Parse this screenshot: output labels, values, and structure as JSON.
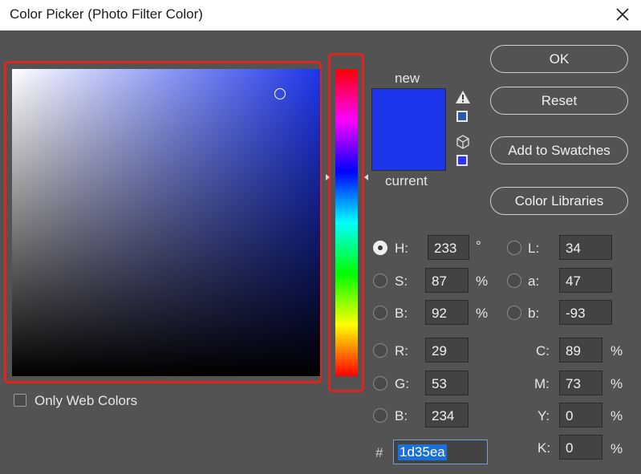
{
  "window": {
    "title": "Color Picker (Photo Filter Color)"
  },
  "preview": {
    "new_label": "new",
    "current_label": "current",
    "new_color": "#1d35ea",
    "current_color": "#1d35ea"
  },
  "buttons": {
    "ok": "OK",
    "reset": "Reset",
    "add_to_swatches": "Add to Swatches",
    "color_libraries": "Color Libraries"
  },
  "hsb": {
    "h": {
      "label": "H:",
      "value": "233",
      "unit": "°"
    },
    "s": {
      "label": "S:",
      "value": "87",
      "unit": "%"
    },
    "b": {
      "label": "B:",
      "value": "92",
      "unit": "%"
    }
  },
  "rgb": {
    "r": {
      "label": "R:",
      "value": "29"
    },
    "g": {
      "label": "G:",
      "value": "53"
    },
    "b": {
      "label": "B:",
      "value": "234"
    }
  },
  "lab": {
    "l": {
      "label": "L:",
      "value": "34"
    },
    "a": {
      "label": "a:",
      "value": "47"
    },
    "b": {
      "label": "b:",
      "value": "-93"
    }
  },
  "cmyk": {
    "c": {
      "label": "C:",
      "value": "89",
      "unit": "%"
    },
    "m": {
      "label": "M:",
      "value": "73",
      "unit": "%"
    },
    "y": {
      "label": "Y:",
      "value": "0",
      "unit": "%"
    },
    "k": {
      "label": "K:",
      "value": "0",
      "unit": "%"
    }
  },
  "hex": {
    "label": "#",
    "value": "1d35ea"
  },
  "only_web_colors": {
    "label": "Only Web Colors",
    "checked": false
  },
  "selected_mode": "H",
  "icons": {
    "out_of_gamut": "warning-icon",
    "web_safe": "cube-icon",
    "close": "close-icon"
  },
  "gamut_swatch_color": "#2e56a8",
  "websafe_swatch_color": "#3333ff"
}
